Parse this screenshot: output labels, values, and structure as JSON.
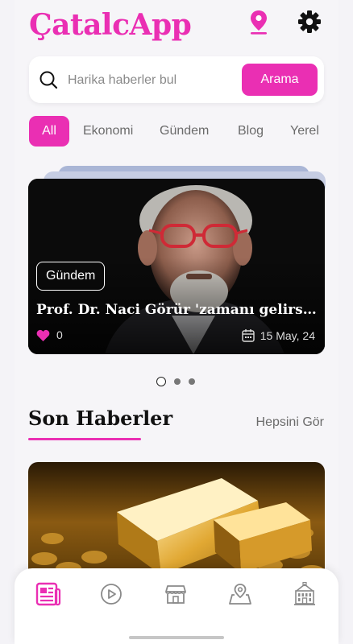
{
  "app": {
    "title": "ÇatalcApp"
  },
  "header": {
    "location_icon": "location-pin-icon",
    "settings_icon": "gear-icon"
  },
  "search": {
    "placeholder": "Harika haberler bul",
    "value": "",
    "button_label": "Arama",
    "icon": "search-icon"
  },
  "tabs": [
    {
      "label": "All",
      "active": true
    },
    {
      "label": "Ekonomi",
      "active": false
    },
    {
      "label": "Gündem",
      "active": false
    },
    {
      "label": "Blog",
      "active": false
    },
    {
      "label": "Yerel",
      "active": false
    }
  ],
  "featured": {
    "category": "Gündem",
    "title": "Prof. Dr. Naci Görür 'zamanı gelirse' ...",
    "likes": "0",
    "date": "15 May, 24"
  },
  "carousel": {
    "count": 3,
    "active_index": 0
  },
  "latest": {
    "title": "Son Haberler",
    "see_all_label": "Hepsini Gör"
  },
  "nav": [
    {
      "icon": "news-icon",
      "active": true
    },
    {
      "icon": "play-icon",
      "active": false
    },
    {
      "icon": "store-icon",
      "active": false
    },
    {
      "icon": "map-icon",
      "active": false
    },
    {
      "icon": "building-icon",
      "active": false
    }
  ],
  "colors": {
    "accent": "#ea2fb3",
    "background": "#f6f5f8",
    "text": "#111111",
    "muted": "#6b6b6b"
  }
}
